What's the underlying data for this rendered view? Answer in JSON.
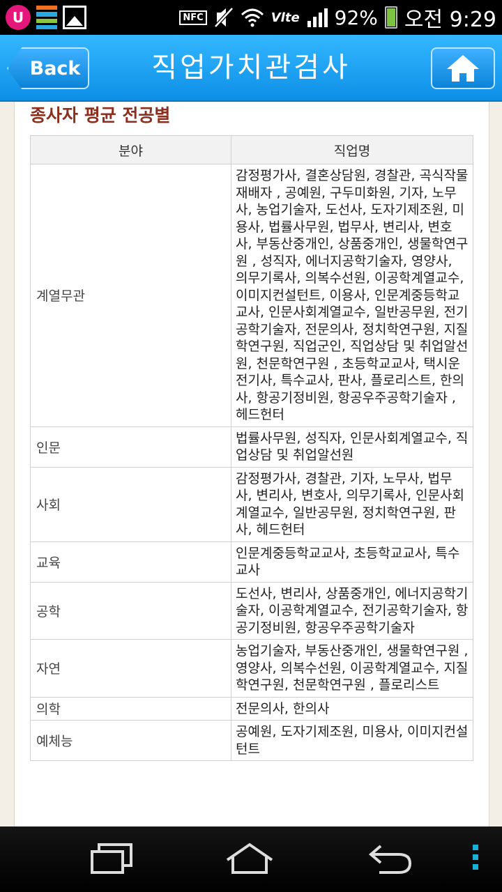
{
  "status_bar": {
    "carrier_badge": "U",
    "nfc_label": "NFC",
    "lte_label": "Vlte",
    "battery_percent": "92%",
    "battery_level": 0.92,
    "time": "오전 9:29",
    "colors": {
      "uplus": "#e5177b",
      "battery": "#7dc242"
    }
  },
  "header": {
    "back_label": "Back",
    "title": "직업가치관검사",
    "home_icon": "home-icon"
  },
  "section": {
    "title": "종사자 평균 전공별"
  },
  "table": {
    "headers": [
      "분야",
      "직업명"
    ],
    "rows": [
      {
        "field": "계열무관",
        "jobs": "감정평가사, 결혼상담원, 경찰관, 곡식작물재배자 , 공예원, 구두미화원, 기자, 노무사, 농업기술자, 도선사, 도자기제조원, 미용사, 법률사무원, 법무사, 변리사, 변호사, 부동산중개인, 상품중개인, 생물학연구원 , 성직자, 에너지공학기술자, 영양사, 의무기록사, 의복수선원, 이공학계열교수, 이미지컨설턴트, 이용사, 인문계중등학교교사, 인문사회계열교수, 일반공무원, 전기공학기술자, 전문의사, 정치학연구원, 지질학연구원, 직업군인, 직업상담 및 취업알선원, 천문학연구원 , 초등학교교사, 택시운전기사, 특수교사, 판사, 플로리스트, 한의사, 항공기정비원, 항공우주공학기술자 , 헤드헌터"
      },
      {
        "field": "인문",
        "jobs": "법률사무원, 성직자, 인문사회계열교수, 직업상담 및 취업알선원"
      },
      {
        "field": "사회",
        "jobs": "감정평가사, 경찰관, 기자, 노무사, 법무사, 변리사, 변호사, 의무기록사, 인문사회계열교수, 일반공무원, 정치학연구원, 판사, 헤드헌터"
      },
      {
        "field": "교육",
        "jobs": "인문계중등학교교사, 초등학교교사, 특수교사"
      },
      {
        "field": "공학",
        "jobs": "도선사, 변리사, 상품중개인, 에너지공학기술자, 이공학계열교수, 전기공학기술자, 항공기정비원, 항공우주공학기술자"
      },
      {
        "field": "자연",
        "jobs": "농업기술자, 부동산중개인, 생물학연구원 , 영양사, 의복수선원, 이공학계열교수, 지질학연구원, 천문학연구원 , 플로리스트"
      },
      {
        "field": "의학",
        "jobs": "전문의사, 한의사"
      },
      {
        "field": "예체능",
        "jobs": "공예원, 도자기제조원, 미용사, 이미지컨설턴트"
      }
    ]
  },
  "nav": {
    "recent_icon": "recent-apps-icon",
    "home_icon": "home-outline-icon",
    "back_icon": "back-arrow-icon",
    "menu_icon": "menu-dots-icon",
    "accent": "#19b2d6"
  }
}
